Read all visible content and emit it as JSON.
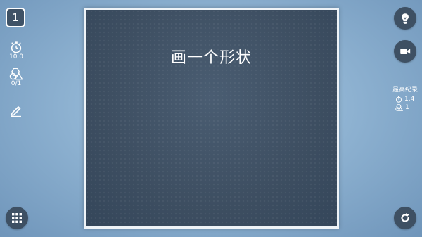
{
  "level": {
    "number": "1"
  },
  "stats": {
    "time": "10.0",
    "shapes": "0/1"
  },
  "board": {
    "instruction": "画一个形状"
  },
  "best_record": {
    "title": "最高纪录",
    "time": "1.4",
    "shapes": "1"
  },
  "icons": {
    "timer": "stopwatch-icon",
    "shapes": "shapes-icon",
    "edit": "pencil-icon",
    "hint": "lightbulb-icon",
    "video": "video-camera-icon",
    "menu": "grid-menu-icon",
    "restart": "restart-icon"
  },
  "colors": {
    "button_bg": "#3e5063",
    "board_bg": "#3f5063",
    "board_border": "#eef3f7"
  }
}
